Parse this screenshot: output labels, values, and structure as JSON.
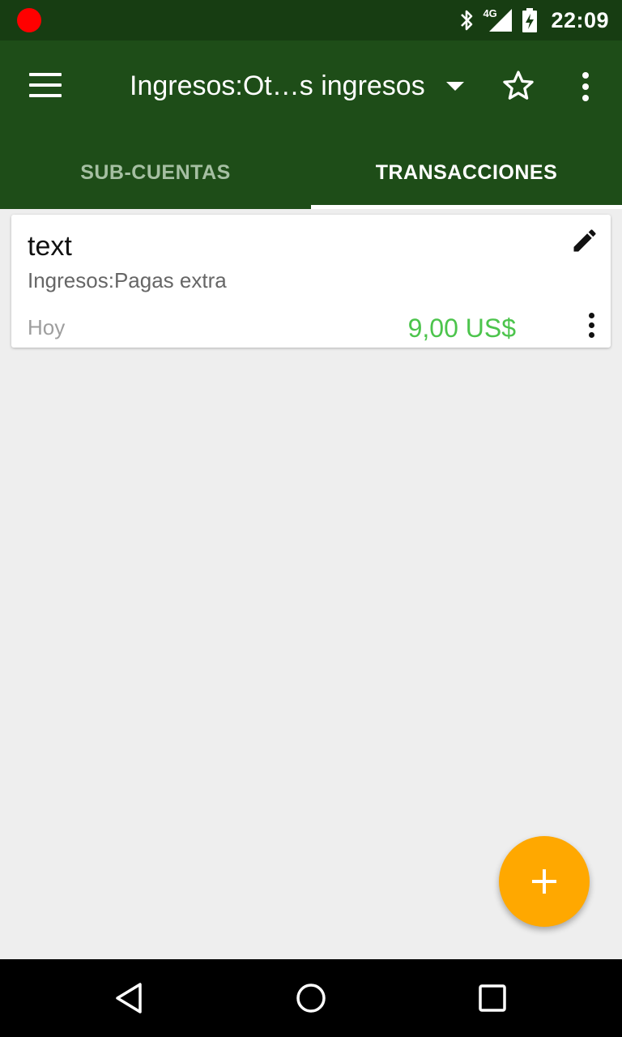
{
  "status_bar": {
    "time": "22:09",
    "network": "4G",
    "icons": [
      "record-indicator-icon",
      "bluetooth-icon",
      "cell-signal-icon",
      "battery-charging-icon"
    ]
  },
  "app_bar": {
    "title": "Ingresos:Ot…s ingresos",
    "icons": [
      "menu-icon",
      "dropdown-arrow-icon",
      "star-outline-icon",
      "overflow-menu-icon"
    ]
  },
  "tabs": [
    {
      "label": "SUB-CUENTAS",
      "active": false
    },
    {
      "label": "TRANSACCIONES",
      "active": true
    }
  ],
  "transactions": [
    {
      "description": "text",
      "account": "Ingresos:Pagas extra",
      "date": "Hoy",
      "amount": "9,00 US$"
    }
  ],
  "colors": {
    "status_bar": "#173d12",
    "app_bar": "#1e4d18",
    "amount_positive": "#4cc44c",
    "fab": "#ffa800",
    "background": "#eeeeee"
  },
  "fab": {
    "icon": "add-icon"
  },
  "nav_bar": {
    "icons": [
      "back-icon",
      "home-icon",
      "recents-icon"
    ]
  }
}
